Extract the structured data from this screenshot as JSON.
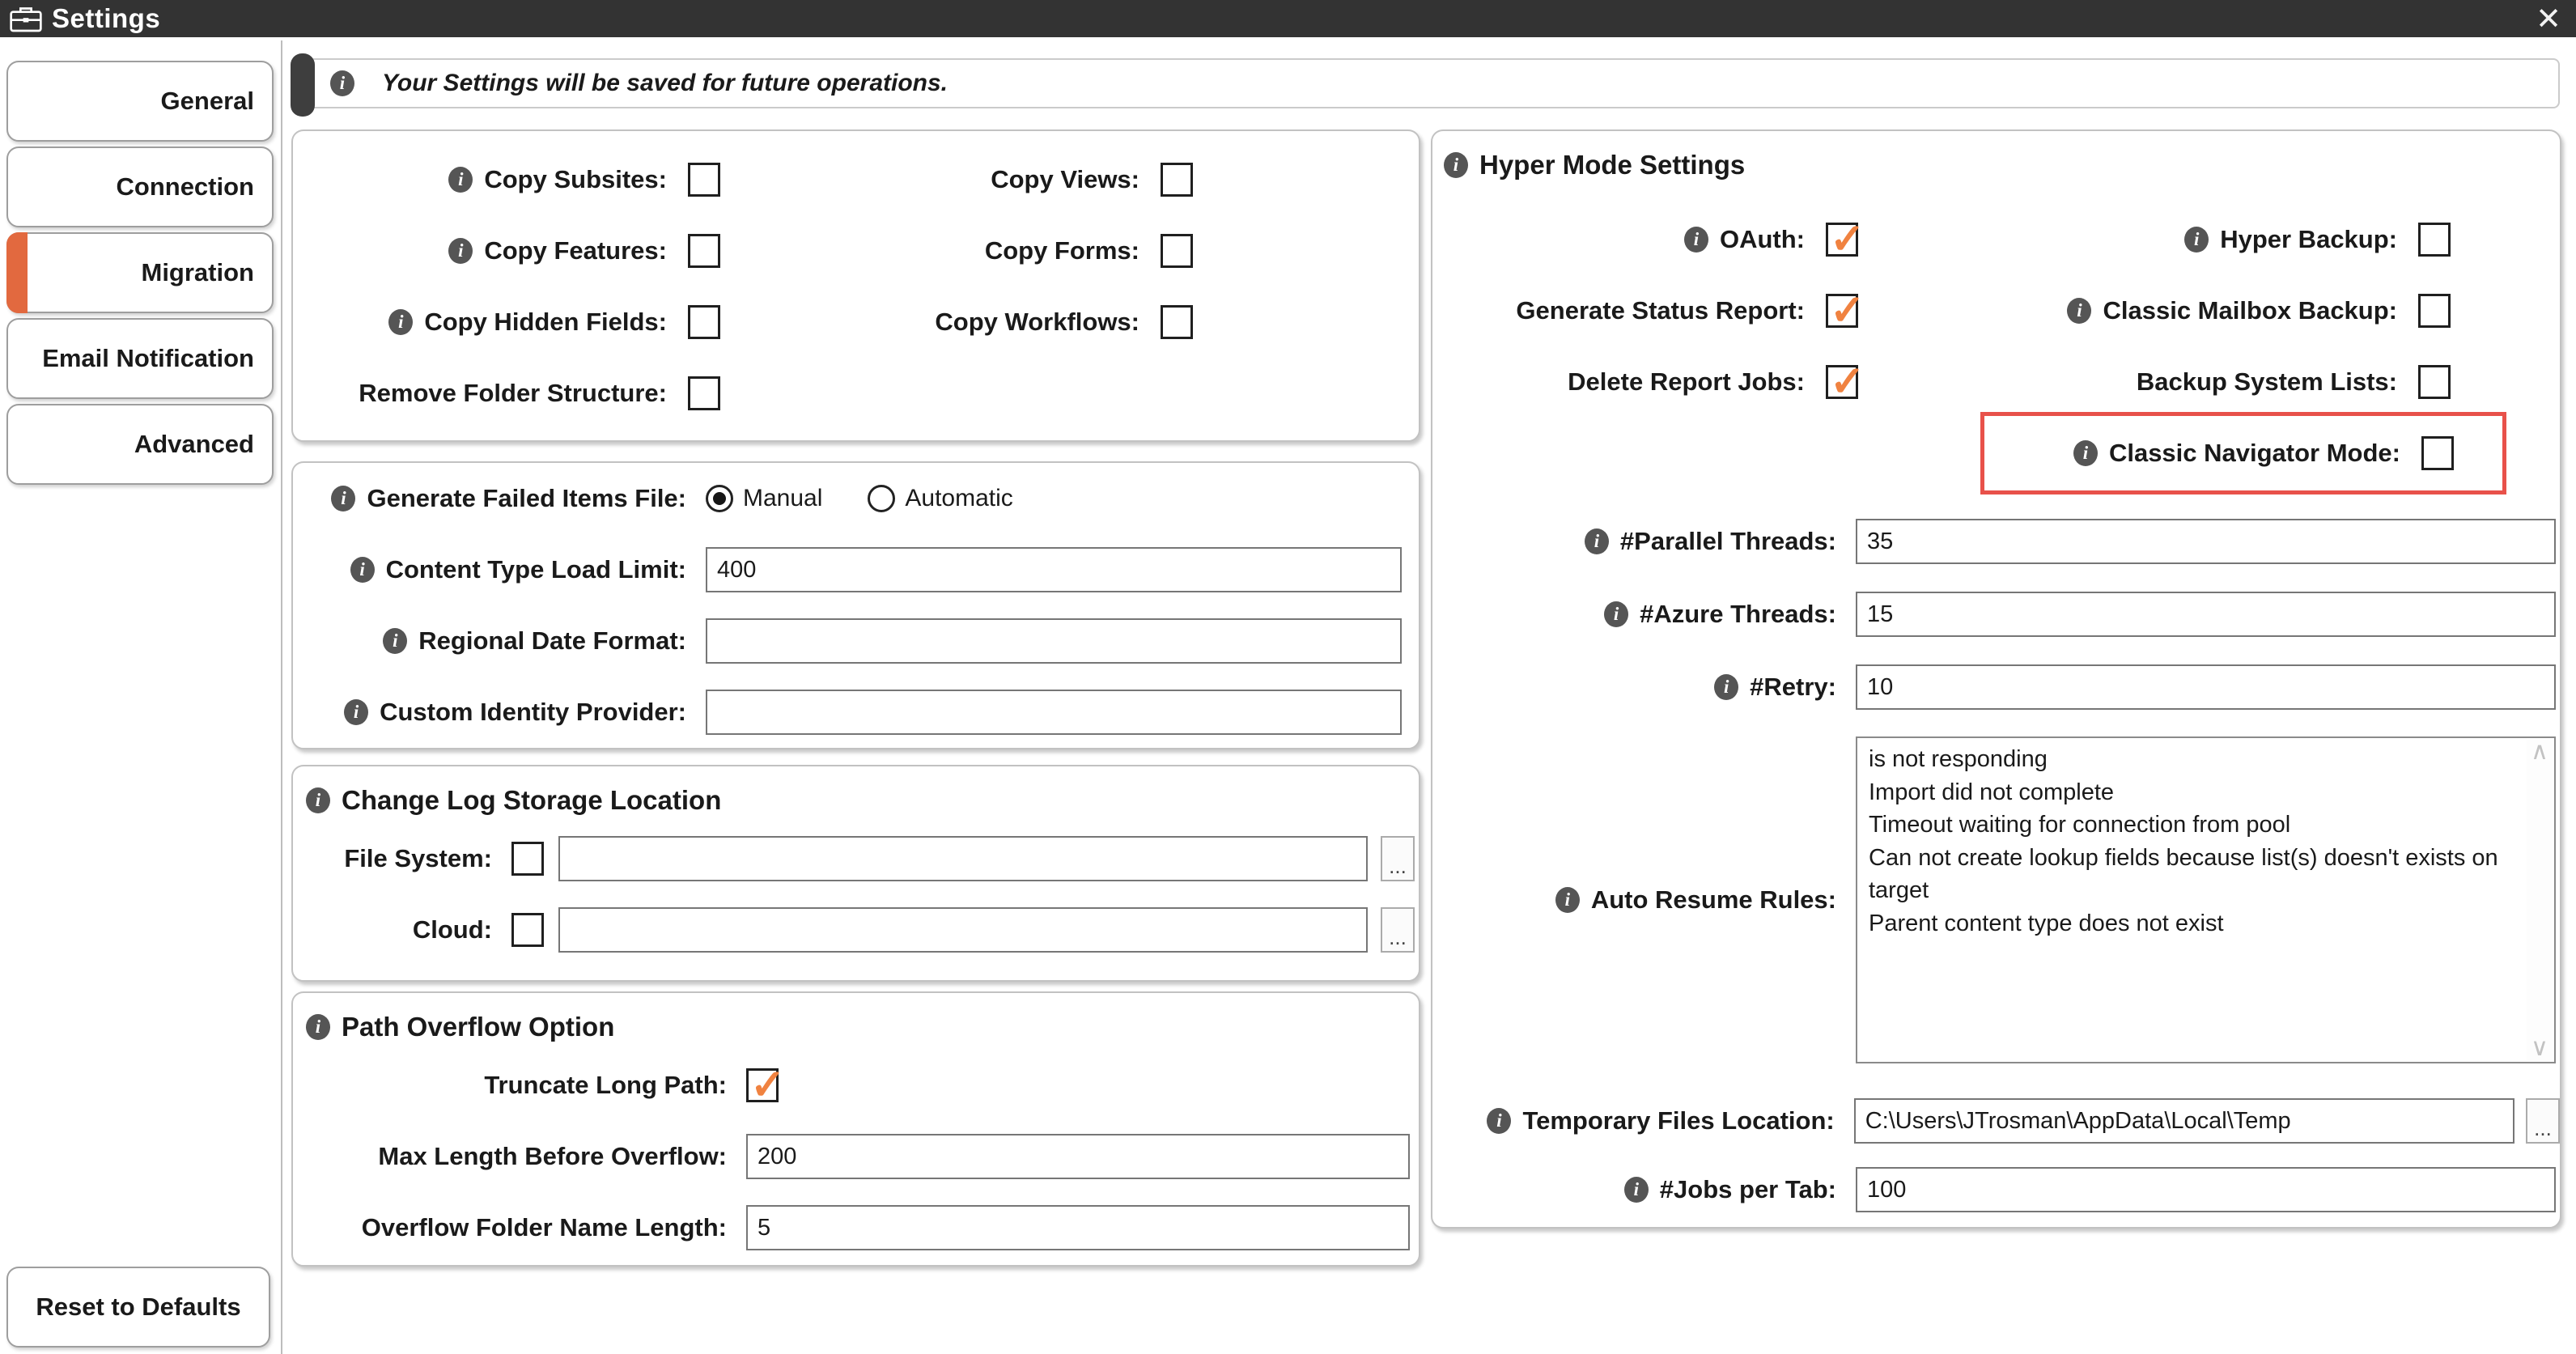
{
  "window": {
    "title": "Settings"
  },
  "banner": {
    "text": "Your Settings will be saved for future operations."
  },
  "sidebar": {
    "tabs": [
      {
        "label": "General"
      },
      {
        "label": "Connection"
      },
      {
        "label": "Migration"
      },
      {
        "label": "Email Notification"
      },
      {
        "label": "Advanced"
      }
    ],
    "active_tab": "Migration",
    "reset_button": "Reset to Defaults"
  },
  "copy_options": {
    "left": [
      {
        "label": "Copy Subsites:",
        "info": true,
        "checked": false
      },
      {
        "label": "Copy Features:",
        "info": true,
        "checked": false
      },
      {
        "label": "Copy Hidden Fields:",
        "info": true,
        "checked": false
      },
      {
        "label": "Remove Folder Structure:",
        "info": false,
        "checked": false
      }
    ],
    "right": [
      {
        "label": "Copy Views:",
        "info": false,
        "checked": false
      },
      {
        "label": "Copy Forms:",
        "info": false,
        "checked": false
      },
      {
        "label": "Copy Workflows:",
        "info": false,
        "checked": false
      }
    ]
  },
  "failed_items": {
    "label": "Generate Failed Items File:",
    "radios": [
      {
        "label": "Manual",
        "selected": true
      },
      {
        "label": "Automatic",
        "selected": false
      }
    ],
    "fields": [
      {
        "label": "Content Type Load Limit:",
        "value": "400"
      },
      {
        "label": "Regional Date Format:",
        "value": ""
      },
      {
        "label": "Custom Identity Provider:",
        "value": ""
      }
    ]
  },
  "change_log": {
    "heading": "Change Log Storage Location",
    "rows": [
      {
        "label": "File System:",
        "checked": false,
        "value": "",
        "browse": "..."
      },
      {
        "label": "Cloud:",
        "checked": false,
        "value": "",
        "browse": "..."
      }
    ]
  },
  "path_overflow": {
    "heading": "Path Overflow Option",
    "truncate_label": "Truncate Long Path:",
    "truncate_checked": true,
    "fields": [
      {
        "label": "Max Length Before Overflow:",
        "value": "200"
      },
      {
        "label": "Overflow Folder Name Length:",
        "value": "5"
      }
    ]
  },
  "hyper": {
    "heading": "Hyper Mode Settings",
    "checkboxes": {
      "left": [
        {
          "label": "OAuth:",
          "info": true,
          "checked": true
        },
        {
          "label": "Generate Status Report:",
          "info": false,
          "checked": true
        },
        {
          "label": "Delete Report Jobs:",
          "info": false,
          "checked": true
        }
      ],
      "right": [
        {
          "label": "Hyper Backup:",
          "info": true,
          "checked": false
        },
        {
          "label": "Classic Mailbox Backup:",
          "info": true,
          "checked": false
        },
        {
          "label": "Backup System Lists:",
          "info": false,
          "checked": false
        },
        {
          "label": "Classic Navigator Mode:",
          "info": true,
          "checked": false,
          "highlighted": true
        }
      ]
    },
    "fields": [
      {
        "label": "#Parallel Threads:",
        "value": "35"
      },
      {
        "label": "#Azure Threads:",
        "value": "15"
      },
      {
        "label": "#Retry:",
        "value": "10"
      }
    ],
    "auto_resume": {
      "label": "Auto Resume Rules:",
      "text": "is not responding\nImport did not complete\nTimeout waiting for connection from pool\nCan not create lookup fields because list(s) doesn't exists on target\nParent content type does not exist"
    },
    "temp_files": {
      "label": "Temporary Files Location:",
      "value": "C:\\Users\\JTrosman\\AppData\\Local\\Temp",
      "browse": "..."
    },
    "jobs_per_tab": {
      "label": "#Jobs per Tab:",
      "value": "100"
    }
  },
  "colors": {
    "accent_orange": "#e2693f",
    "check_orange": "#f08240",
    "highlight_red": "#e8514a",
    "titlebar": "#333333"
  }
}
